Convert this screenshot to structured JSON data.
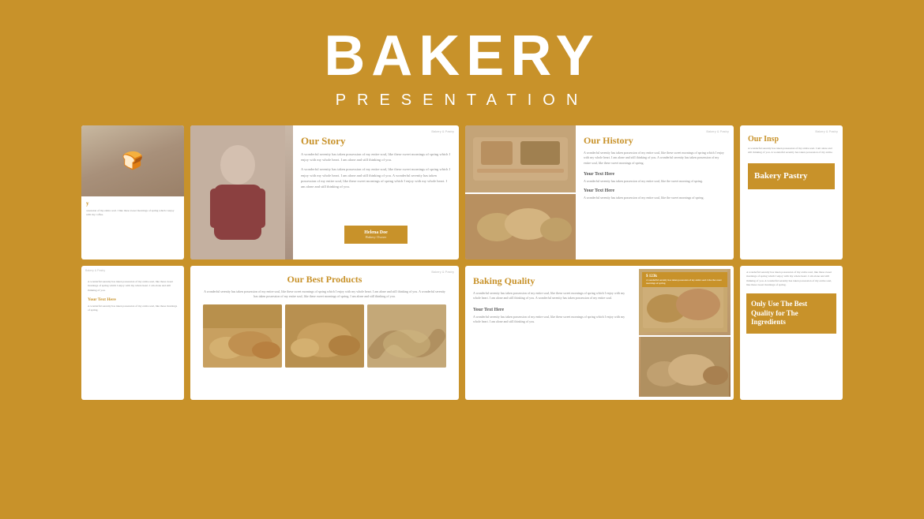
{
  "header": {
    "title": "BAKERY",
    "subtitle": "PRESENTATION"
  },
  "slides": {
    "slide1": {
      "tag": "Bakery & Pastry",
      "title": "Our Story",
      "body1": "A wonderful serenity has taken possession of my entire soul, like these sweet mornings of spring which I enjoy with my whole heart. I am alone and still thinking of you.",
      "body2": "A wonderful serenity has taken possession of my entire soul, like these sweet mornings of spring which I enjoy with my whole heart. I am alone and still thinking of you. A wonderful serenity has taken possession of my entire soul, like these sweet mornings of spring which I enjoy with my whole heart. I am alone and still thinking of you.",
      "author_name": "Helena Doe",
      "author_role": "Bakery Owner"
    },
    "slide2": {
      "tag": "Bakery & Pastry",
      "title": "Our History",
      "body": "A wonderful serenity has taken possession of my entire soul, like these sweet mornings of spring which I enjoy with my whole heart. I am alone and still thinking of you. A wonderful serenity has taken possession of my entire soul, like these sweet mornings of spring.",
      "subheading1": "Your Text Here",
      "subtext1": "A wonderful serenity has taken possession of my entire soul, like the sweet morning of spring.",
      "subheading2": "Your Text Here",
      "subtext2": "A wonderful serenity has taken possession of my entire soul, like the sweet mornings of spring."
    },
    "slide3": {
      "tag": "Bakery & Pastry",
      "title": "Our Insp",
      "body": "A wonderful serenity has taken possession of my entire soul. I am alone and still thinking of you. A wonderful serenity has taken possession of my entire.",
      "box_title": "Bakery Pastry"
    },
    "slide4_left": {
      "tag": "Bakery & Pastry",
      "body": "A wonderful serenity has taken possession of my entire soul, like these sweet mornings of spring which I enjoy with my whole heart. I am alone and still thinking of you.",
      "subheading": "Your Text Here",
      "subtext": "A wonderful serenity has taken possession of my entire soul, like these mornings of spring."
    },
    "slide5": {
      "tag": "Bakery & Pastry",
      "title": "Our Best Products",
      "body": "A wonderful serenity has taken possession of my entire soul, like these sweet mornings of spring which I enjoy with my whole heart. I am alone and still thinking of you. A wonderful serenity has taken possession of my entire soul, like these sweet mornings of spring. I am alone and still thinking of you."
    },
    "slide6": {
      "tag": "Bakery & Pastry",
      "title": "Baking Quality",
      "body": "A wonderful serenity has taken possession of my entire soul, like these sweet mornings of spring which I enjoy with my whole heart. I am alone and still thinking of you. A wonderful serenity has taken possession of my entire soul.",
      "subheading": "Your Text Here",
      "subtext": "A wonderful serenity has taken possession of my entire soul, like these sweet mornings of spring which I enjoy with my whole heart. I am alone and still thinking of you.",
      "price_badge": "$ 123k",
      "price_desc": "A wonderful serenity has taken possession of my entire soul. Like the sweet mornings of spring."
    },
    "slide7_right": {
      "body": "A wonderful serenity has taken possession of my entire soul, like these sweet mornings of spring which I enjoy with my whole heart. I am alone and still thinking of you. A wonderful serenity has taken possession of my entire soul, like these sweet mornings of spring.",
      "box_title": "Only Use The Best Quality for The Ingredients"
    }
  }
}
